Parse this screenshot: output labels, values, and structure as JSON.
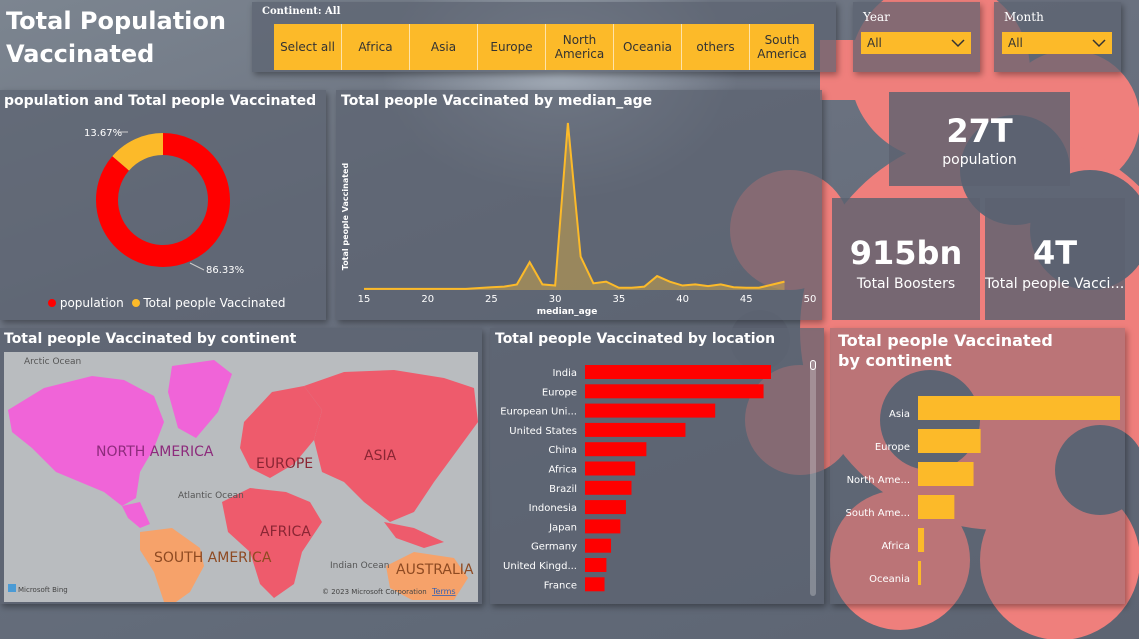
{
  "page_title": "Total Population Vaccinated",
  "slicer": {
    "header": "Continent: All",
    "buttons": [
      "Select all",
      "Africa",
      "Asia",
      "Europe",
      "North America",
      "Oceania",
      "others",
      "South America"
    ]
  },
  "filters": {
    "year": {
      "label": "Year",
      "selected": "All"
    },
    "month": {
      "label": "Month",
      "selected": "All"
    }
  },
  "donut": {
    "title": "population and Total people Vaccinated",
    "label_small": "13.67%",
    "label_large": "86.33%",
    "legend": [
      "population",
      "Total people Vaccinated"
    ],
    "colors": {
      "population": "#ff0000",
      "vaccinated": "#fcba29"
    }
  },
  "line_chart_title": "Total people Vaccinated by median_age",
  "map": {
    "title": "Total people Vaccinated by continent",
    "labels": [
      "Arctic Ocean",
      "NORTH AMERICA",
      "EUROPE",
      "ASIA",
      "Atlantic Ocean",
      "AFRICA",
      "SOUTH AMERICA",
      "Indian Ocean",
      "AUSTRALIA"
    ],
    "bing": "Microsoft Bing",
    "copyright": "© 2023 Microsoft Corporation",
    "terms": "Terms"
  },
  "cards": {
    "population": {
      "value": "27T",
      "label": "population"
    },
    "boosters": {
      "value": "915bn",
      "label": "Total Boosters"
    },
    "vaccinated": {
      "value": "4T",
      "label": "Total people Vaccin..."
    }
  },
  "location_chart_title": "Total people Vaccinated by location",
  "continent_chart_title": "Total people Vaccinated by continent",
  "chart_data": [
    {
      "type": "pie",
      "title": "population and Total people Vaccinated",
      "categories": [
        "population",
        "Total people Vaccinated"
      ],
      "values": [
        86.33,
        13.67
      ],
      "colors": [
        "#ff0000",
        "#fcba29"
      ]
    },
    {
      "type": "area",
      "title": "Total people Vaccinated by median_age",
      "xlabel": "median_age",
      "ylabel": "Total people Vaccinated",
      "xlim": [
        15,
        50
      ],
      "xticks": [
        15,
        20,
        25,
        30,
        35,
        40,
        45,
        50
      ],
      "x": [
        15,
        17,
        19,
        21,
        23,
        25,
        26,
        27,
        28,
        29,
        30,
        31,
        32,
        33,
        34,
        35,
        36,
        37,
        38,
        39,
        40,
        41,
        42,
        43,
        44,
        45,
        46,
        48
      ],
      "y": [
        0.2,
        0.2,
        0.2,
        0.2,
        0.2,
        0.5,
        0.6,
        1.0,
        5.0,
        1.0,
        0.8,
        30.0,
        6.0,
        1.2,
        1.5,
        0.4,
        0.4,
        0.6,
        2.5,
        1.5,
        0.8,
        1.0,
        0.7,
        1.0,
        0.5,
        0.4,
        0.4,
        1.5
      ]
    },
    {
      "type": "bar",
      "title": "Total people Vaccinated by location",
      "categories": [
        "India",
        "Europe",
        "European Uni...",
        "United States",
        "China",
        "Africa",
        "Brazil",
        "Indonesia",
        "Japan",
        "Germany",
        "United Kingd...",
        "France"
      ],
      "values": [
        1000,
        960,
        700,
        540,
        330,
        270,
        250,
        220,
        190,
        140,
        115,
        105
      ],
      "color": "#ff0000"
    },
    {
      "type": "bar",
      "title": "Total people Vaccinated by continent",
      "categories": [
        "Asia",
        "Europe",
        "North Ame...",
        "South Ame...",
        "Africa",
        "Oceania"
      ],
      "values": [
        1000,
        310,
        275,
        180,
        30,
        15
      ],
      "color": "#fcba29"
    }
  ]
}
